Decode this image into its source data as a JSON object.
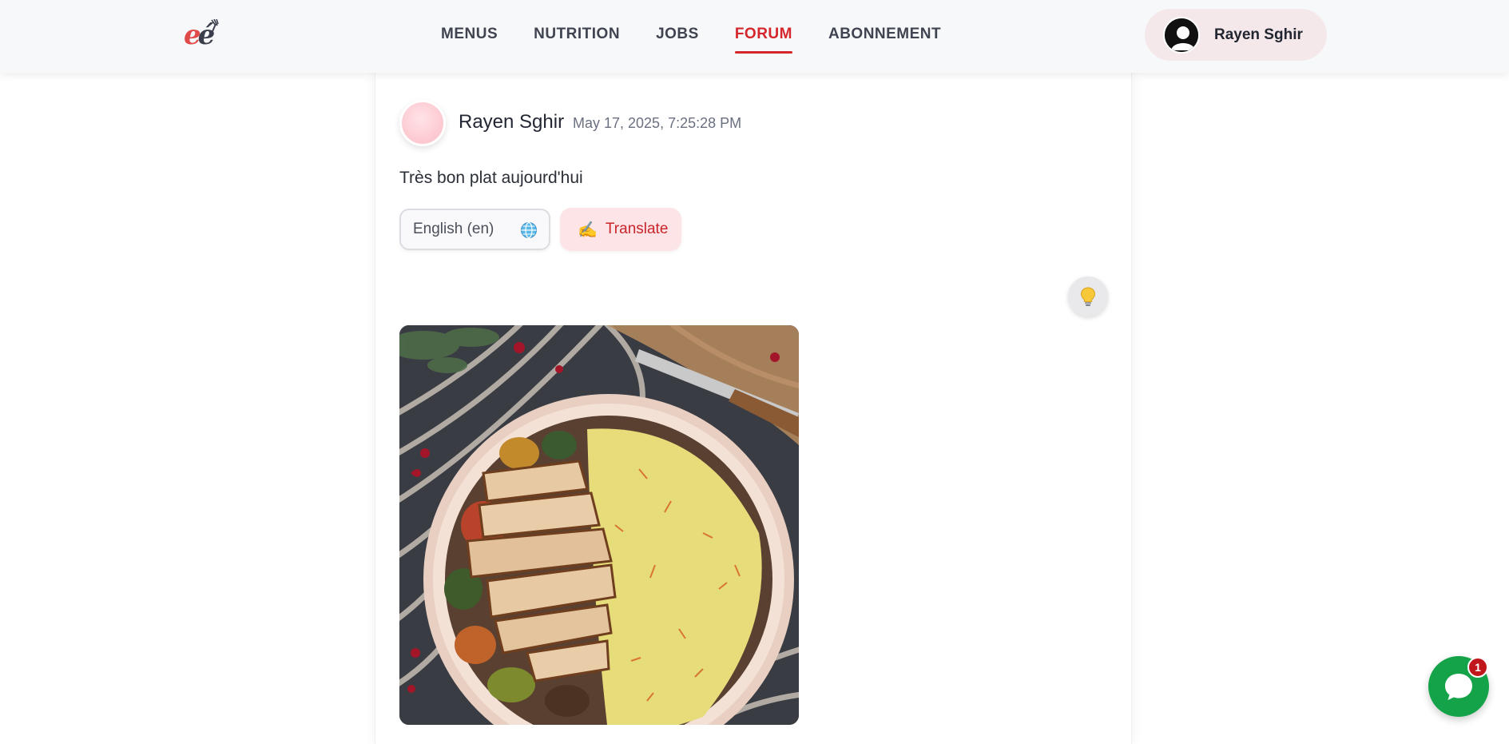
{
  "header": {
    "logo": {
      "icon": "chef-logo-icon"
    },
    "nav": [
      {
        "label": "MENUS",
        "active": false
      },
      {
        "label": "NUTRITION",
        "active": false
      },
      {
        "label": "JOBS",
        "active": false
      },
      {
        "label": "FORUM",
        "active": true
      },
      {
        "label": "ABONNEMENT",
        "active": false
      }
    ],
    "user": {
      "name": "Rayen Sghir",
      "avatar_icon": "user-avatar-icon"
    }
  },
  "post": {
    "author": "Rayen Sghir",
    "date": "May 17, 2025, 7:25:28 PM",
    "text": "Très bon plat aujourd'hui",
    "language_select": {
      "value": "English (en)",
      "icon": "globe-icon"
    },
    "translate_button": {
      "label": "Translate",
      "icon": "writing-hand-icon"
    },
    "idea_button": {
      "icon": "lightbulb-icon"
    },
    "image": {
      "icon": "food-photo"
    }
  },
  "chat": {
    "badge_count": "1",
    "icon": "chat-bubble-icon"
  },
  "colors": {
    "accent": "#d4262b",
    "nav_text": "#3f4450",
    "chip_bg": "#f5e8ea",
    "translate_bg": "#fde4e7",
    "chat_green": "#15a34a",
    "badge_red": "#c0171c"
  }
}
